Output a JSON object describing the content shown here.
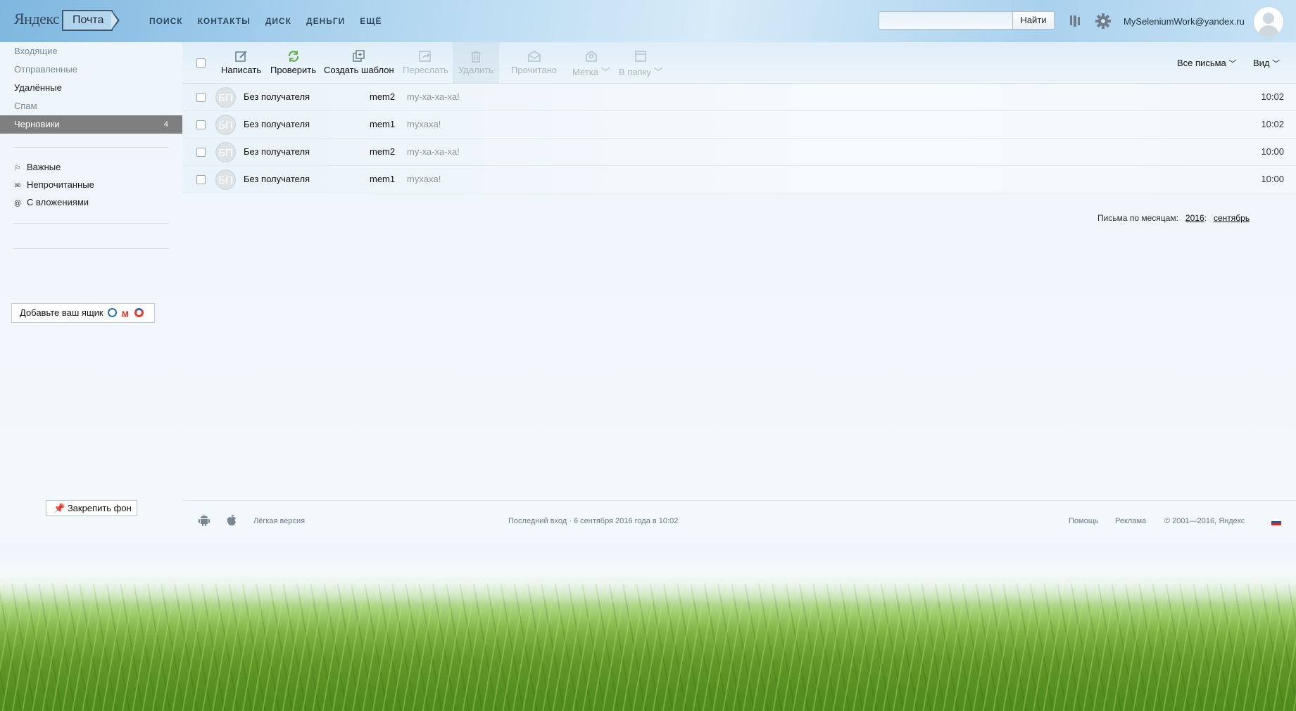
{
  "header": {
    "logo": "Яндекс",
    "service": "Почта",
    "nav": [
      "ПОИСК",
      "КОНТАКТЫ",
      "ДИСК",
      "ДЕНЬГИ",
      "ЕЩЁ"
    ],
    "search_placeholder": "",
    "search_button": "Найти",
    "user_email": "MySeleniumWork@yandex.ru"
  },
  "sidebar": {
    "folders": [
      {
        "label": "Входящие",
        "count": ""
      },
      {
        "label": "Отправленные",
        "count": ""
      },
      {
        "label": "Удалённые",
        "count": ""
      },
      {
        "label": "Спам",
        "count": ""
      },
      {
        "label": "Черновики",
        "count": "4"
      }
    ],
    "labels": [
      "Важные",
      "Непрочитанные",
      "С вложениями"
    ],
    "add_mailbox": "Добавьте ваш ящик",
    "pin_background": "Закрепить фон"
  },
  "toolbar": {
    "compose": "Написать",
    "check": "Проверить",
    "template": "Создать шаблон",
    "forward": "Переслать",
    "delete": "Удалить",
    "read": "Прочитано",
    "label": "Метка",
    "to_folder": "В папку",
    "filter": "Все письма",
    "view": "Вид"
  },
  "messages": [
    {
      "avatar": "БП",
      "from": "Без получателя",
      "subject": "mem2",
      "snippet": "my-ха-ха-ха!",
      "time": "10:02"
    },
    {
      "avatar": "БП",
      "from": "Без получателя",
      "subject": "mem1",
      "snippet": "myxaxa!",
      "time": "10:02"
    },
    {
      "avatar": "БП",
      "from": "Без получателя",
      "subject": "mem2",
      "snippet": "my-ха-ха-ха!",
      "time": "10:00"
    },
    {
      "avatar": "БП",
      "from": "Без получателя",
      "subject": "mem1",
      "snippet": "myxaxa!",
      "time": "10:00"
    }
  ],
  "archive": {
    "label": "Письма по месяцам:",
    "year": "2016",
    "sep": ":",
    "month": "сентябрь"
  },
  "footer": {
    "light_version": "Лёгкая версия",
    "last_login": "Последний вход · 6 сентября 2016 года в 10:02",
    "help": "Помощь",
    "ads": "Реклама",
    "copyright": "© 2001—2016, Яндекс"
  },
  "colors": {
    "active_folder_bg": "#7d7f80",
    "accent_green": "#5aab3a"
  }
}
